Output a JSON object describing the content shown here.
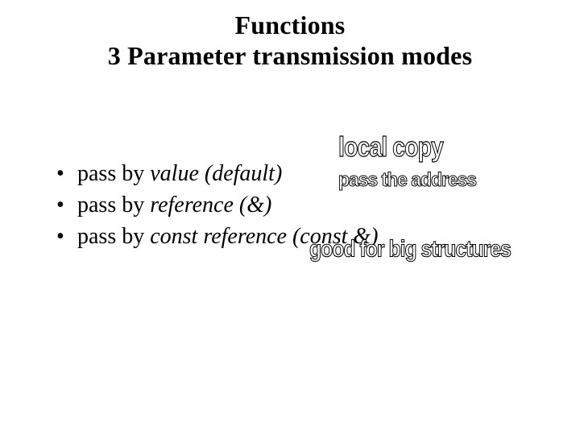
{
  "title": {
    "line1": "Functions",
    "line2": "3 Parameter transmission modes"
  },
  "bullets": [
    {
      "prefix": "pass by ",
      "emph": "value (default)"
    },
    {
      "prefix": "pass by ",
      "emph": "reference (&)"
    },
    {
      "prefix": "pass by ",
      "emph": "const reference (const &)"
    }
  ],
  "annotations": {
    "local_copy": "local copy",
    "pass_address": "pass the address",
    "big_structures": "good for big structures"
  }
}
